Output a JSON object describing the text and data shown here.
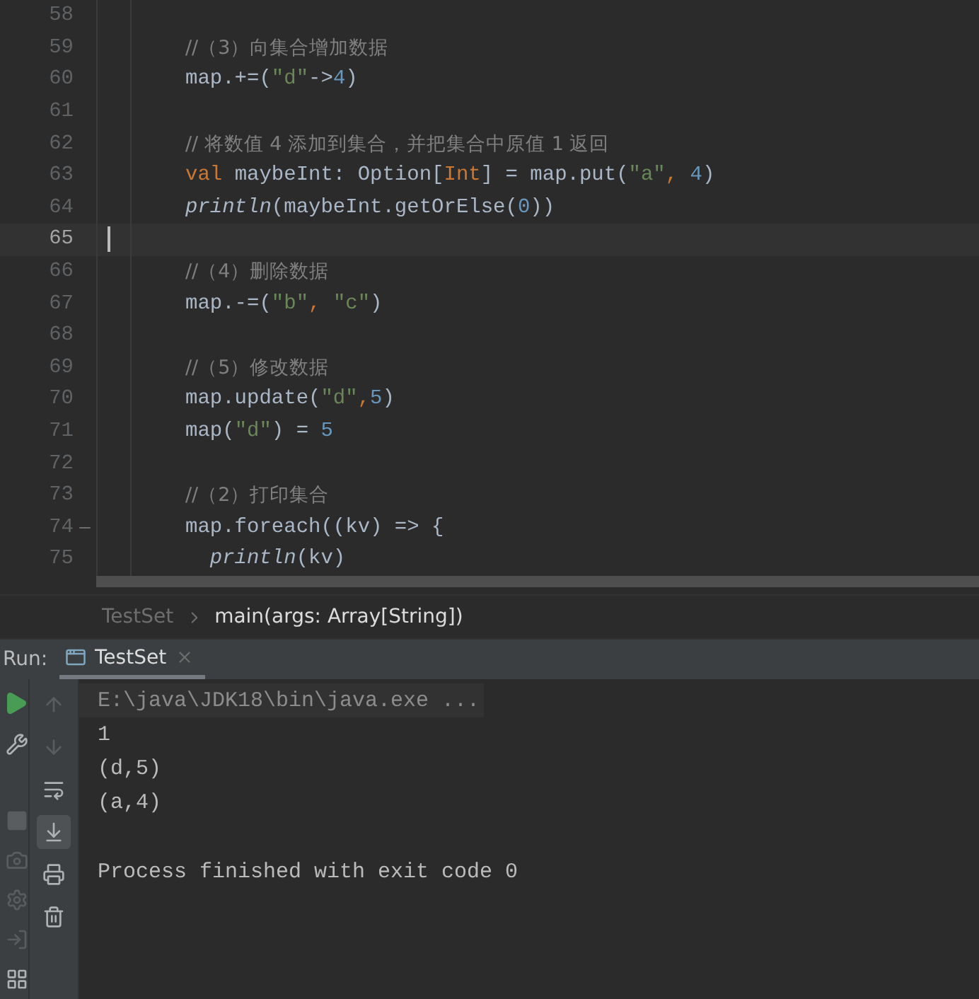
{
  "editor": {
    "lines": [
      {
        "number": "58",
        "current": false,
        "foldable": false
      },
      {
        "number": "59",
        "current": false,
        "foldable": false,
        "tokens": [
          {
            "kind": "comment",
            "text": "//（3）向集合增加数据"
          }
        ]
      },
      {
        "number": "60",
        "current": false,
        "foldable": false,
        "tokens": [
          {
            "kind": "plain",
            "text": "map.+=("
          },
          {
            "kind": "string",
            "text": "\"d\""
          },
          {
            "kind": "plain",
            "text": "->"
          },
          {
            "kind": "number",
            "text": "4"
          },
          {
            "kind": "plain",
            "text": ")"
          }
        ]
      },
      {
        "number": "61",
        "current": false,
        "foldable": false
      },
      {
        "number": "62",
        "current": false,
        "foldable": false,
        "tokens": [
          {
            "kind": "comment",
            "text": "// 将数值 4 添加到集合，并把集合中原值 1 返回"
          }
        ]
      },
      {
        "number": "63",
        "current": false,
        "foldable": false,
        "tokens": [
          {
            "kind": "keyword",
            "text": "val "
          },
          {
            "kind": "plain",
            "text": "maybeInt: Option["
          },
          {
            "kind": "keyword",
            "text": "Int"
          },
          {
            "kind": "plain",
            "text": "] = map.put("
          },
          {
            "kind": "string",
            "text": "\"a\""
          },
          {
            "kind": "keyword",
            "text": ", "
          },
          {
            "kind": "number",
            "text": "4"
          },
          {
            "kind": "plain",
            "text": ")"
          }
        ]
      },
      {
        "number": "64",
        "current": false,
        "foldable": false,
        "tokens": [
          {
            "kind": "call",
            "text": "println"
          },
          {
            "kind": "plain",
            "text": "(maybeInt.getOrElse("
          },
          {
            "kind": "number",
            "text": "0"
          },
          {
            "kind": "plain",
            "text": "))"
          }
        ]
      },
      {
        "number": "65",
        "current": true,
        "foldable": false
      },
      {
        "number": "66",
        "current": false,
        "foldable": false,
        "tokens": [
          {
            "kind": "comment",
            "text": "//（4）删除数据"
          }
        ]
      },
      {
        "number": "67",
        "current": false,
        "foldable": false,
        "tokens": [
          {
            "kind": "plain",
            "text": "map.-=("
          },
          {
            "kind": "string",
            "text": "\"b\""
          },
          {
            "kind": "keyword",
            "text": ", "
          },
          {
            "kind": "string",
            "text": "\"c\""
          },
          {
            "kind": "plain",
            "text": ")"
          }
        ]
      },
      {
        "number": "68",
        "current": false,
        "foldable": false
      },
      {
        "number": "69",
        "current": false,
        "foldable": false,
        "tokens": [
          {
            "kind": "comment",
            "text": "//（5）修改数据"
          }
        ]
      },
      {
        "number": "70",
        "current": false,
        "foldable": false,
        "tokens": [
          {
            "kind": "plain",
            "text": "map.update("
          },
          {
            "kind": "string",
            "text": "\"d\""
          },
          {
            "kind": "keyword",
            "text": ","
          },
          {
            "kind": "number",
            "text": "5"
          },
          {
            "kind": "plain",
            "text": ")"
          }
        ]
      },
      {
        "number": "71",
        "current": false,
        "foldable": false,
        "tokens": [
          {
            "kind": "plain",
            "text": "map("
          },
          {
            "kind": "string",
            "text": "\"d\""
          },
          {
            "kind": "plain",
            "text": ") = "
          },
          {
            "kind": "number",
            "text": "5"
          }
        ]
      },
      {
        "number": "72",
        "current": false,
        "foldable": false
      },
      {
        "number": "73",
        "current": false,
        "foldable": false,
        "tokens": [
          {
            "kind": "comment",
            "text": "//（2）打印集合"
          }
        ]
      },
      {
        "number": "74",
        "current": false,
        "foldable": true,
        "tokens": [
          {
            "kind": "plain",
            "text": "map.foreach((kv) => {"
          }
        ]
      },
      {
        "number": "75",
        "current": false,
        "foldable": false,
        "tokens": [
          {
            "kind": "call",
            "text": "  println"
          },
          {
            "kind": "plain",
            "text": "(kv)"
          }
        ]
      }
    ]
  },
  "breadcrumb": [
    "TestSet",
    "main(args: Array[String])"
  ],
  "run_panel": {
    "label": "Run:",
    "tabs": [
      {
        "label": "TestSet",
        "selected": true
      }
    ],
    "console": [
      {
        "kind": "command",
        "text": "E:\\java\\JDK18\\bin\\java.exe ..."
      },
      {
        "kind": "output",
        "text": "1"
      },
      {
        "kind": "output",
        "text": "(d,5)"
      },
      {
        "kind": "output",
        "text": "(a,4)"
      },
      {
        "kind": "status",
        "text": "Process finished with exit code 0"
      }
    ]
  }
}
